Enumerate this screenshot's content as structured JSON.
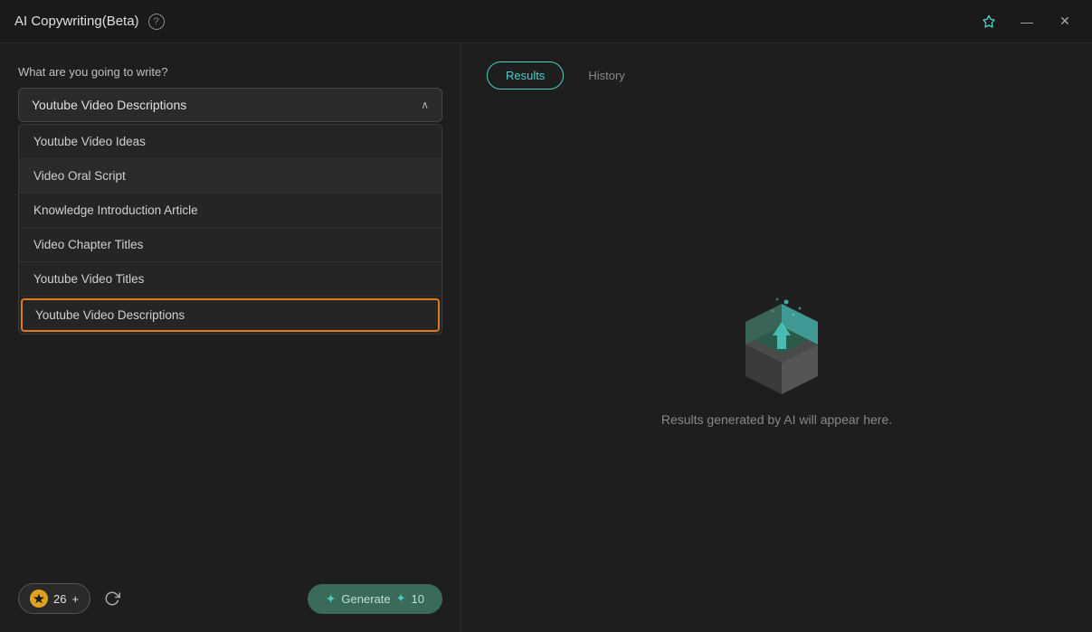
{
  "app": {
    "title": "AI Copywriting(Beta)",
    "pin_icon": "📌",
    "minimize_icon": "—",
    "close_icon": "✕"
  },
  "left_panel": {
    "label": "What are you going to write?",
    "dropdown": {
      "selected": "Youtube Video Descriptions",
      "arrow": "∧",
      "options": [
        {
          "id": "youtube-video-ideas",
          "label": "Youtube Video Ideas",
          "state": "normal"
        },
        {
          "id": "video-oral-script",
          "label": "Video Oral Script",
          "state": "highlighted"
        },
        {
          "id": "knowledge-introduction-article",
          "label": "Knowledge Introduction Article",
          "state": "normal"
        },
        {
          "id": "video-chapter-titles",
          "label": "Video Chapter Titles",
          "state": "normal"
        },
        {
          "id": "youtube-video-titles",
          "label": "Youtube Video Titles",
          "state": "normal"
        },
        {
          "id": "youtube-video-descriptions",
          "label": "Youtube Video Descriptions",
          "state": "selected-active"
        }
      ]
    },
    "bottom": {
      "credits_count": "26",
      "credits_plus": "+",
      "generate_label": "Generate",
      "generate_cost": "10"
    }
  },
  "right_panel": {
    "tabs": [
      {
        "id": "results",
        "label": "Results",
        "active": true
      },
      {
        "id": "history",
        "label": "History",
        "active": false
      }
    ],
    "empty_state_text": "Results generated by AI will appear here."
  }
}
